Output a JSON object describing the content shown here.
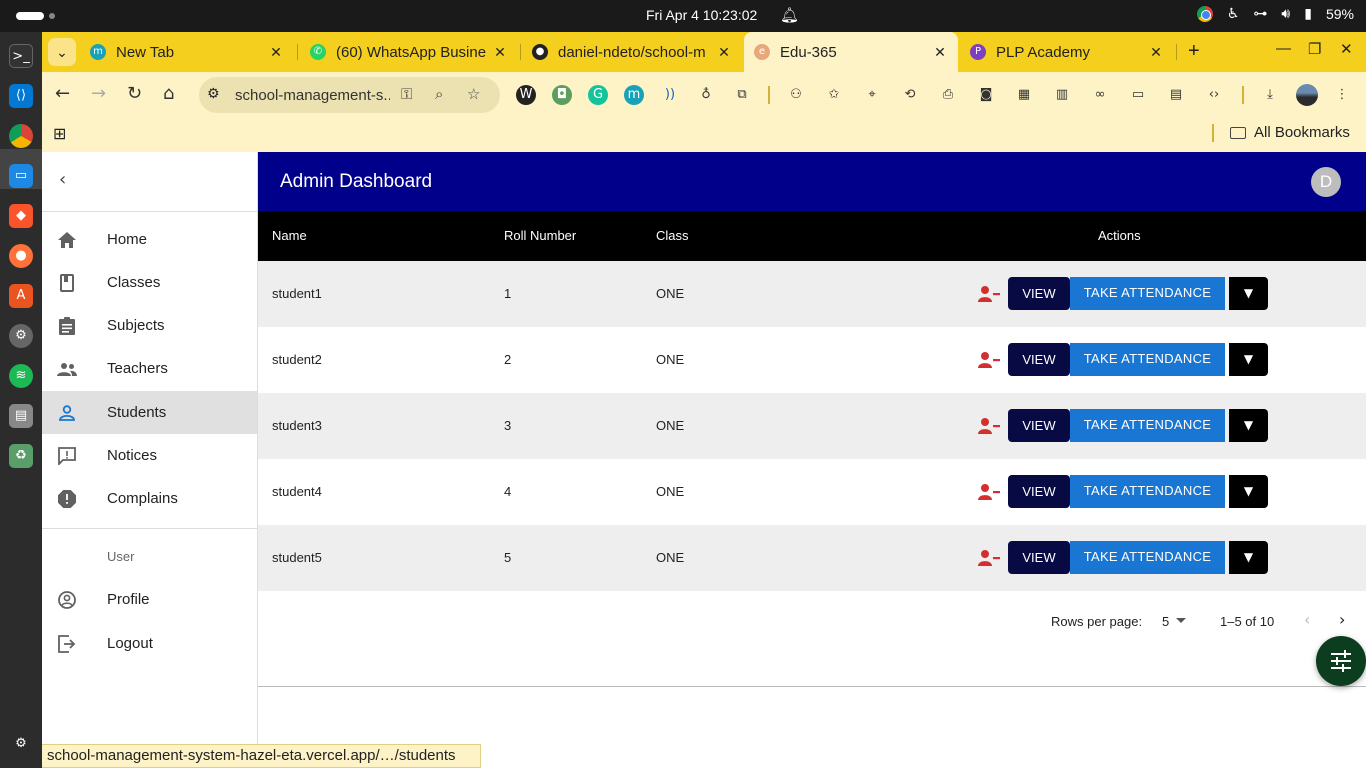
{
  "os": {
    "clock": "Fri Apr 4  10:23:02",
    "battery": "59%"
  },
  "tabs": [
    {
      "title": "New Tab",
      "favicon": "m-icon",
      "favicon_color": "#17a2b8",
      "favicon_letter": "m"
    },
    {
      "title": "(60) WhatsApp Busine",
      "favicon": "whatsapp-icon",
      "favicon_color": "#25d366",
      "favicon_letter": "✆"
    },
    {
      "title": "daniel-ndeto/school-m",
      "favicon": "github-icon",
      "favicon_color": "#222222",
      "favicon_letter": "●"
    },
    {
      "title": "Edu-365",
      "favicon": "edu-icon",
      "favicon_color": "#e8a87c",
      "favicon_letter": "e"
    },
    {
      "title": "PLP Academy",
      "favicon": "plp-icon",
      "favicon_color": "#7b3fbf",
      "favicon_letter": "P"
    }
  ],
  "toolbar": {
    "url": "school-management-s..."
  },
  "bookmarks": {
    "all_label": "All Bookmarks"
  },
  "app": {
    "title": "Admin Dashboard",
    "avatar_letter": "D",
    "accent": "#00008b"
  },
  "sidebar": {
    "items": [
      {
        "label": "Home",
        "icon": "home-icon"
      },
      {
        "label": "Classes",
        "icon": "class-icon"
      },
      {
        "label": "Subjects",
        "icon": "assignment-icon"
      },
      {
        "label": "Teachers",
        "icon": "supervisor-icon"
      },
      {
        "label": "Students",
        "icon": "person-icon",
        "selected": true
      },
      {
        "label": "Notices",
        "icon": "announcement-icon"
      },
      {
        "label": "Complains",
        "icon": "report-icon"
      }
    ],
    "section_label": "User",
    "user_items": [
      {
        "label": "Profile",
        "icon": "account-circle-icon"
      },
      {
        "label": "Logout",
        "icon": "logout-icon"
      }
    ]
  },
  "table": {
    "columns": [
      "Name",
      "Roll Number",
      "Class",
      "Actions"
    ],
    "rows": [
      {
        "name": "student1",
        "roll": "1",
        "class": "ONE"
      },
      {
        "name": "student2",
        "roll": "2",
        "class": "ONE"
      },
      {
        "name": "student3",
        "roll": "3",
        "class": "ONE"
      },
      {
        "name": "student4",
        "roll": "4",
        "class": "ONE"
      },
      {
        "name": "student5",
        "roll": "5",
        "class": "ONE"
      }
    ],
    "view_label": "VIEW",
    "attendance_label": "TAKE ATTENDANCE"
  },
  "pagination": {
    "rows_per_page_label": "Rows per page:",
    "rows_per_page_value": "5",
    "range": "1–5 of 10"
  },
  "status_url": "school-management-system-hazel-eta.vercel.app/…/students"
}
